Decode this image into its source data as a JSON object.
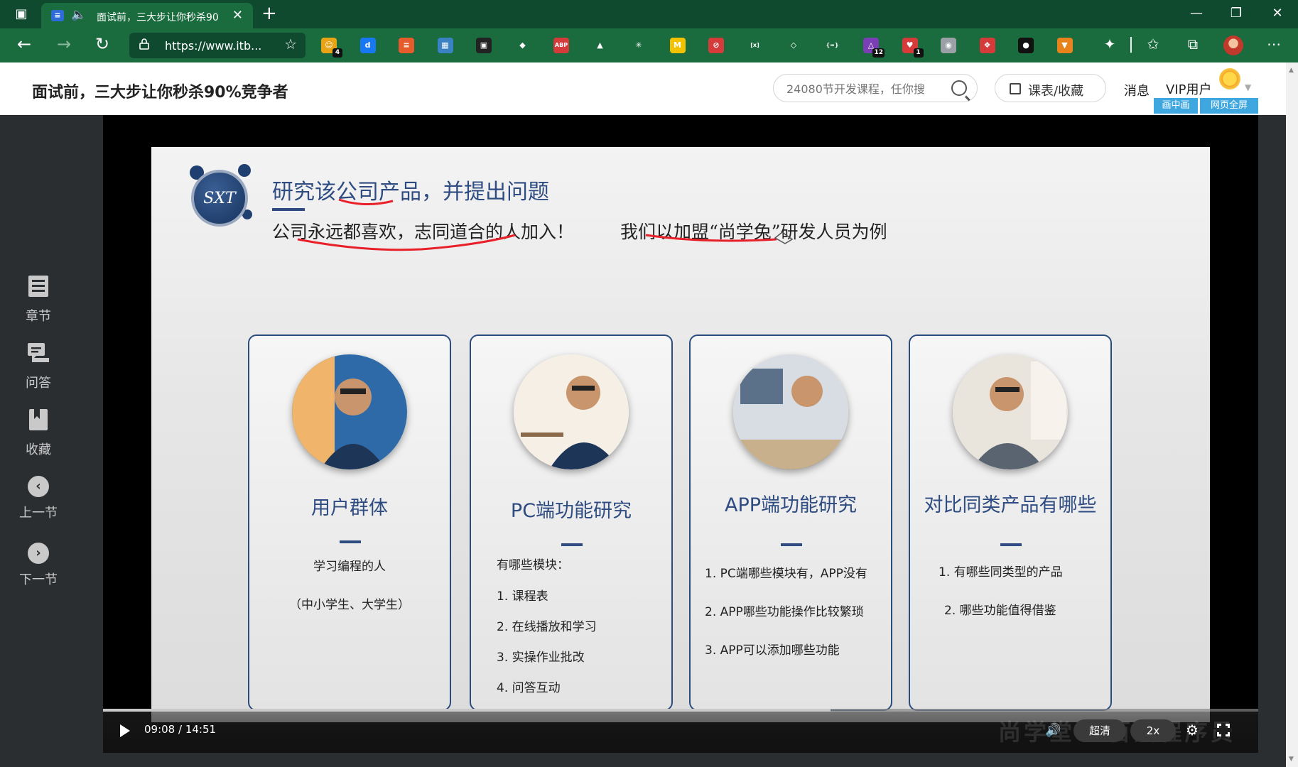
{
  "browser": {
    "tab_title": "面试前，三大步让你秒杀90",
    "url": "https://www.itb...",
    "extensions": [
      {
        "name": "ext-1",
        "color": "#e8a317",
        "glyph": "☺",
        "badge": "4"
      },
      {
        "name": "ext-2",
        "color": "#1877f2",
        "glyph": "d",
        "badge": ""
      },
      {
        "name": "ext-3",
        "color": "#e55b2b",
        "glyph": "≡",
        "badge": ""
      },
      {
        "name": "ext-4",
        "color": "#3b82c4",
        "glyph": "▦",
        "badge": ""
      },
      {
        "name": "ext-5",
        "color": "#222222",
        "glyph": "▣",
        "badge": ""
      },
      {
        "name": "ext-6",
        "color": "#1a6b3e",
        "glyph": "◆",
        "badge": ""
      },
      {
        "name": "ext-abp",
        "color": "#d63b3b",
        "glyph": "ABP",
        "badge": ""
      },
      {
        "name": "ext-8",
        "color": "#1a6b3e",
        "glyph": "▲",
        "badge": ""
      },
      {
        "name": "ext-9",
        "color": "#1a6b3e",
        "glyph": "✳",
        "badge": ""
      },
      {
        "name": "ext-10",
        "color": "#f2c200",
        "glyph": "M",
        "badge": ""
      },
      {
        "name": "ext-11",
        "color": "#d63b3b",
        "glyph": "⊘",
        "badge": ""
      },
      {
        "name": "ext-12",
        "color": "#1a6b3e",
        "glyph": "[x]",
        "badge": ""
      },
      {
        "name": "ext-13",
        "color": "#1a6b3e",
        "glyph": "◇",
        "badge": ""
      },
      {
        "name": "ext-14",
        "color": "#1a6b3e",
        "glyph": "{=}",
        "badge": ""
      },
      {
        "name": "ext-15",
        "color": "#7b3fb5",
        "glyph": "△",
        "badge": "12"
      },
      {
        "name": "ext-16",
        "color": "#d63b3b",
        "glyph": "♥",
        "badge": "1"
      },
      {
        "name": "ext-17",
        "color": "#9aa0a6",
        "glyph": "◉",
        "badge": ""
      },
      {
        "name": "ext-18",
        "color": "#d63b3b",
        "glyph": "❖",
        "badge": ""
      },
      {
        "name": "ext-19",
        "color": "#111111",
        "glyph": "●",
        "badge": ""
      },
      {
        "name": "ext-20",
        "color": "#e8821c",
        "glyph": "▼",
        "badge": ""
      }
    ]
  },
  "header": {
    "title": "面试前，三大步让你秒杀90%竞争者",
    "search_placeholder": "24080节开发课程，任你搜",
    "schedule_label": "课表/收藏",
    "messages_label": "消息",
    "vip_label": "VIP用户",
    "pip_label": "画中画",
    "fullpage_label": "网页全屏"
  },
  "sidebar": {
    "items": [
      {
        "label": "章节"
      },
      {
        "label": "问答"
      },
      {
        "label": "收藏"
      },
      {
        "label": "上一节"
      },
      {
        "label": "下一节"
      }
    ]
  },
  "slide": {
    "logo_text": "SXT",
    "heading": "研究该公司产品，并提出问题",
    "subline": "公司永远都喜欢，志同道合的人加入！",
    "sample": "我们以加盟“尚学兔”研发人员为例",
    "cards": [
      {
        "title": "用户群体",
        "lines": [
          "学习编程的人",
          "（中小学生、大学生）"
        ]
      },
      {
        "title": "PC端功能研究",
        "lines": [
          "有哪些模块：",
          "1. 课程表",
          "2. 在线播放和学习",
          "3. 实操作业批改",
          "4. 问答互动"
        ]
      },
      {
        "title": "APP端功能研究",
        "lines": [
          "1. PC端哪些模块有，APP没有",
          "2. APP哪些功能操作比较繁琐",
          "3. APP可以添加哪些功能"
        ]
      },
      {
        "title": "对比同类产品有哪些",
        "lines": [
          "1. 有哪些同类型的产品",
          "2. 哪些功能值得借鉴"
        ]
      }
    ]
  },
  "player": {
    "time": "09:08 / 14:51",
    "progress_fraction": 0.63,
    "quality_label": "超清",
    "speed_label": "2x",
    "watermark": "尚学堂 · 百战程序员"
  }
}
